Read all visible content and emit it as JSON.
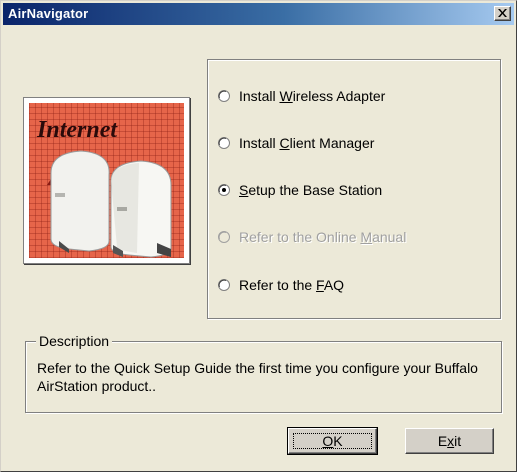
{
  "window": {
    "title": "AirNavigator",
    "close_icon": "close-x-icon"
  },
  "image": {
    "caption": "Internet"
  },
  "options": [
    {
      "pre": "Install ",
      "key": "W",
      "post": "ireless Adapter",
      "selected": false,
      "enabled": true
    },
    {
      "pre": "Install ",
      "key": "C",
      "post": "lient Manager",
      "selected": false,
      "enabled": true
    },
    {
      "pre": "",
      "key": "S",
      "post": "etup the Base Station",
      "selected": true,
      "enabled": true
    },
    {
      "pre": "Refer to the Online ",
      "key": "M",
      "post": "anual",
      "selected": false,
      "enabled": false
    },
    {
      "pre": "Refer to the ",
      "key": "F",
      "post": "AQ",
      "selected": false,
      "enabled": true
    }
  ],
  "description": {
    "legend": "Description",
    "text": "Refer to the Quick Setup Guide the first time you configure your Buffalo AirStation product.."
  },
  "buttons": {
    "ok": {
      "pre": "",
      "key": "O",
      "post": "K"
    },
    "exit": {
      "pre": "E",
      "key": "x",
      "post": "it"
    }
  }
}
